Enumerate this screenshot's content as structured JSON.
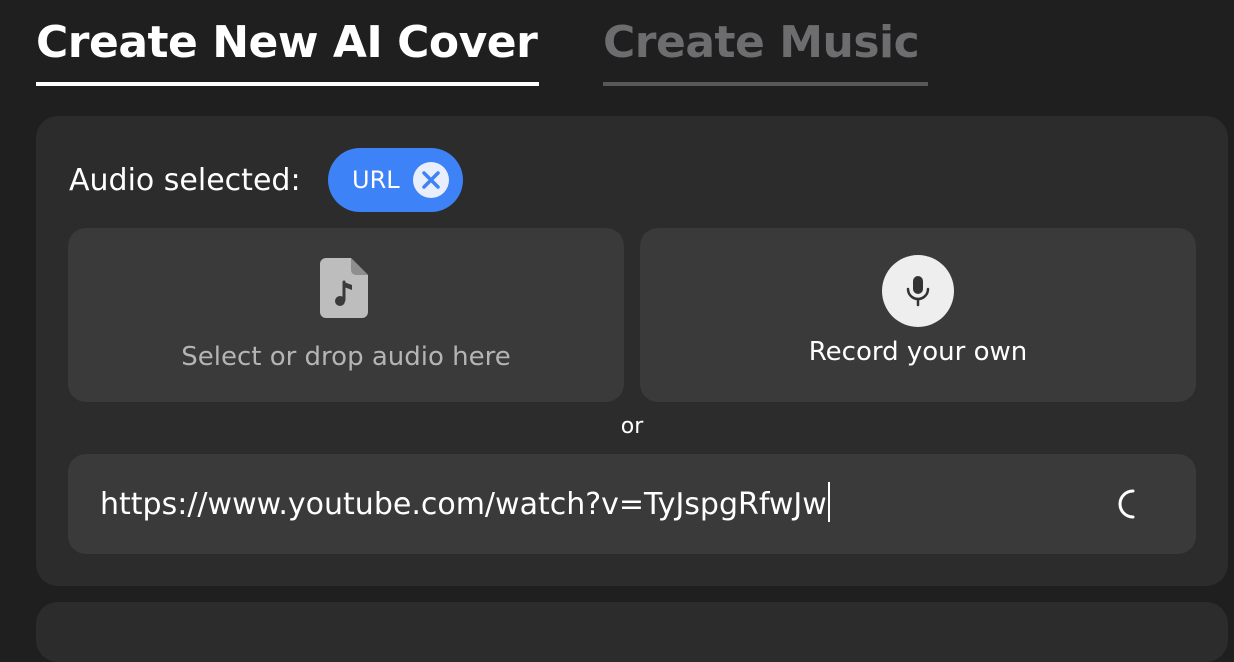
{
  "tabs": [
    {
      "label": "Create New AI Cover",
      "active": true
    },
    {
      "label": "Create Music",
      "active": false
    }
  ],
  "audio": {
    "label": "Audio selected:",
    "chip_label": "URL"
  },
  "upload": {
    "label": "Select or drop audio here",
    "icon": "file-music-icon"
  },
  "record": {
    "label": "Record your own",
    "icon": "microphone-icon"
  },
  "divider": "or",
  "url_input": {
    "value": "https://www.youtube.com/watch?v=TyJspgRfwJw"
  },
  "colors": {
    "background": "#1f1f1f",
    "panel": "#2c2c2c",
    "card": "#3a3a3a",
    "accent": "#3d82f6"
  }
}
